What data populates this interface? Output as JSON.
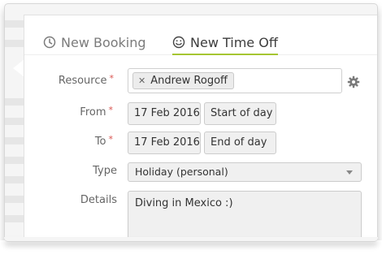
{
  "tabs": [
    {
      "label": "New Booking",
      "icon": "clock-icon",
      "active": false
    },
    {
      "label": "New Time Off",
      "icon": "smiley-icon",
      "active": true
    }
  ],
  "form": {
    "resource": {
      "label": "Resource",
      "required_mark": "*",
      "token": "Andrew Rogoff",
      "remove_glyph": "✕"
    },
    "from": {
      "label": "From",
      "required_mark": "*",
      "date": "17 Feb 2016",
      "time": "Start of day"
    },
    "to": {
      "label": "To",
      "required_mark": "*",
      "date": "17 Feb 2016",
      "time": "End of day"
    },
    "type": {
      "label": "Type",
      "value": "Holiday (personal)"
    },
    "details": {
      "label": "Details",
      "value": "Diving in Mexico :)"
    }
  },
  "colors": {
    "accent": "#a5c632",
    "required": "#d9534f"
  }
}
